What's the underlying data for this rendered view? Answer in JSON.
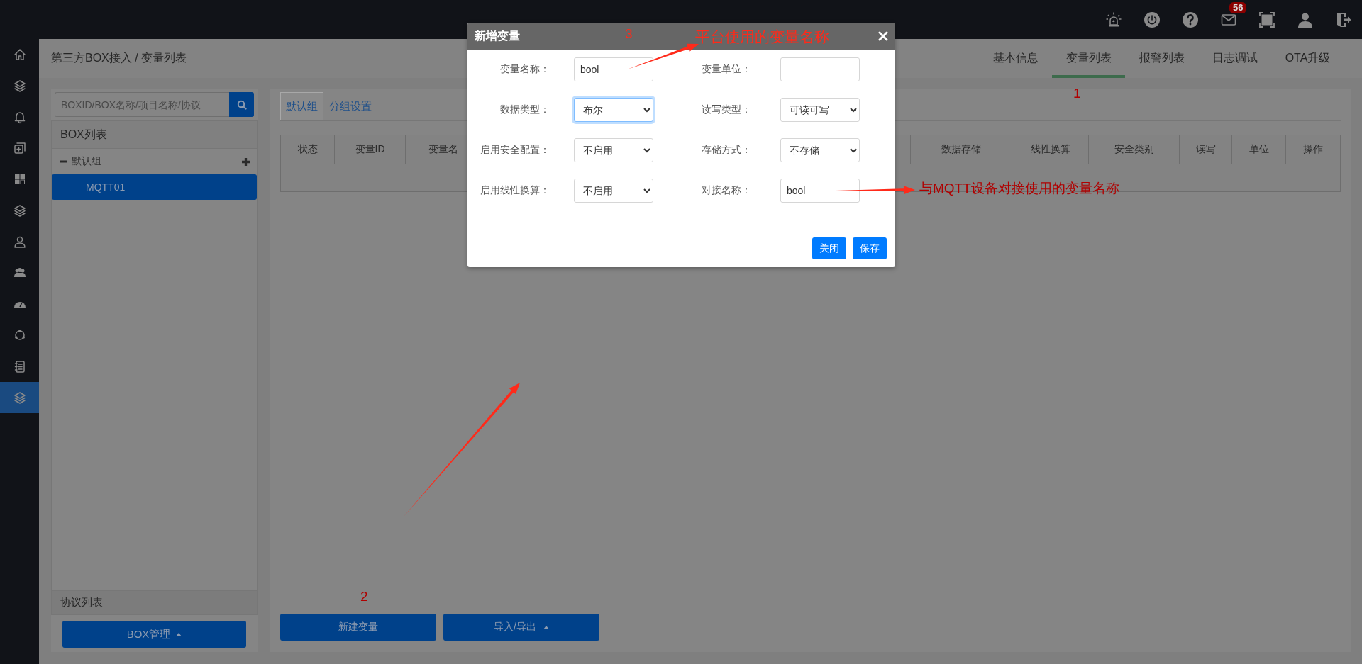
{
  "topbar": {
    "badge": "56"
  },
  "sidebar": {
    "items": [
      {
        "selected": false
      },
      {
        "selected": false
      },
      {
        "selected": false
      },
      {
        "selected": false
      },
      {
        "selected": false
      },
      {
        "selected": false
      },
      {
        "selected": false
      },
      {
        "selected": false
      },
      {
        "selected": false
      },
      {
        "selected": false
      },
      {
        "selected": false
      },
      {
        "selected": true
      }
    ]
  },
  "breadcrumb": "第三方BOX接入 / 变量列表",
  "tabs": [
    {
      "label": "基本信息",
      "selected": false
    },
    {
      "label": "变量列表",
      "selected": true
    },
    {
      "label": "报警列表",
      "selected": false
    },
    {
      "label": "日志调试",
      "selected": false
    },
    {
      "label": "OTA升级",
      "selected": false
    }
  ],
  "box_panel": {
    "search": {
      "placeholder": "BOXID/BOX名称/项目名称/协议"
    },
    "list_title": "BOX列表",
    "groups": [
      {
        "label": "默认组",
        "expanded": true,
        "children": [
          {
            "label": "MQTT01",
            "selected": true
          }
        ]
      }
    ],
    "footer_title": "协议列表",
    "manage_button": "BOX管理"
  },
  "var_panel": {
    "tabs": [
      {
        "label": "默认组",
        "selected": true
      },
      {
        "label": "分组设置",
        "selected": false
      }
    ],
    "table": {
      "columns": [
        "状态",
        "变量ID",
        "变量名",
        "数据存储",
        "线性换算",
        "安全类别",
        "读写",
        "单位",
        "操作"
      ]
    },
    "buttons": [
      {
        "label": "新建变量",
        "dropdown": false
      },
      {
        "label": "导入/导出",
        "dropdown": true
      }
    ]
  },
  "dialog": {
    "title": "新增变量",
    "fields": [
      {
        "label": "变量名称：",
        "kind": "input",
        "value": "bool",
        "focused": false
      },
      {
        "label": "变量单位：",
        "kind": "input",
        "focused": false
      },
      {
        "label": "数据类型：",
        "kind": "select",
        "value": "布尔",
        "focused": true
      },
      {
        "label": "读写类型：",
        "kind": "select",
        "value": "可读可写",
        "focused": false
      },
      {
        "label": "启用安全配置：",
        "kind": "select",
        "value": "不启用",
        "focused": false
      },
      {
        "label": "存储方式：",
        "kind": "select",
        "value": "不存储",
        "focused": false
      },
      {
        "label": "启用线性换算：",
        "kind": "select",
        "value": "不启用",
        "focused": false
      },
      {
        "label": "对接名称：",
        "kind": "input",
        "value": "bool",
        "focused": false
      }
    ],
    "buttons": [
      "关闭",
      "保存"
    ]
  },
  "annotations": [
    {
      "text": "3"
    },
    {
      "text": "平台使用的变量名称"
    },
    {
      "text": "1"
    },
    {
      "text": "与MQTT设备对接使用的变量名称"
    },
    {
      "text": "2"
    }
  ]
}
